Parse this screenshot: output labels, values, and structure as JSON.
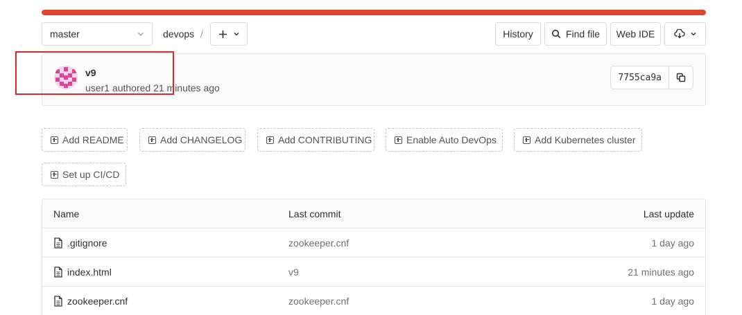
{
  "pipeline": {
    "progress_percent": 100,
    "color": "#e24329"
  },
  "toolbar": {
    "branch": "master",
    "project": "devops",
    "separator": "/",
    "history_label": "History",
    "find_file_label": "Find file",
    "web_ide_label": "Web IDE",
    "add_icon": "plus-icon",
    "download_icon": "cloud-download-icon"
  },
  "commit": {
    "title": "v9",
    "meta": "user1 authored 21 minutes ago",
    "sha": "7755ca9a",
    "copy_icon": "copy-icon"
  },
  "quick_actions": [
    {
      "label": "Add README"
    },
    {
      "label": "Add CHANGELOG"
    },
    {
      "label": "Add CONTRIBUTING"
    },
    {
      "label": "Enable Auto DevOps"
    },
    {
      "label": "Add Kubernetes cluster"
    },
    {
      "label": "Set up CI/CD"
    }
  ],
  "file_tree": {
    "columns": {
      "name": "Name",
      "last_commit": "Last commit",
      "last_update": "Last update"
    },
    "rows": [
      {
        "name": ".gitignore",
        "commit": "zookeeper.cnf",
        "updated": "1 day ago"
      },
      {
        "name": "index.html",
        "commit": "v9",
        "updated": "21 minutes ago"
      },
      {
        "name": "zookeeper.cnf",
        "commit": "zookeeper.cnf",
        "updated": "1 day ago"
      }
    ]
  },
  "colors": {
    "accent": "#e24329",
    "highlight": "#d42c2c",
    "avatar": "#e0439a"
  }
}
